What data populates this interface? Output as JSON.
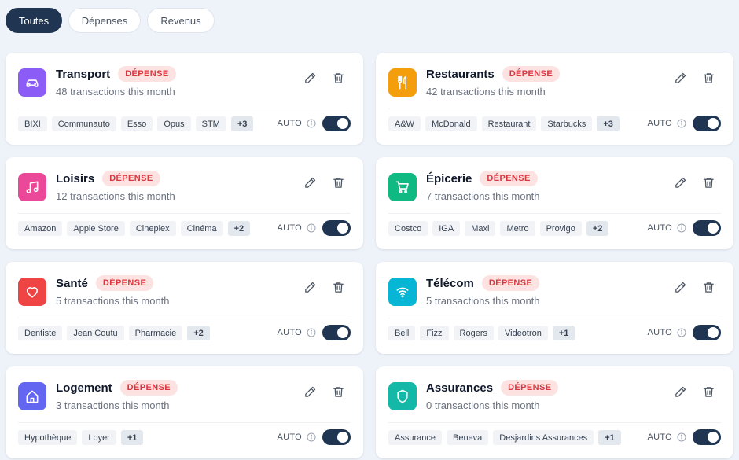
{
  "filters": [
    {
      "label": "Toutes",
      "active": true
    },
    {
      "label": "Dépenses",
      "active": false
    },
    {
      "label": "Revenus",
      "active": false
    }
  ],
  "categories": [
    {
      "name": "Transport",
      "badge": "DÉPENSE",
      "subtitle": "48 transactions this month",
      "icon": "car-icon",
      "color": "#8b5cf6",
      "tags": [
        "BIXI",
        "Communauto",
        "Esso",
        "Opus",
        "STM"
      ],
      "more": "+3",
      "auto_label": "AUTO",
      "auto_enabled": true
    },
    {
      "name": "Restaurants",
      "badge": "DÉPENSE",
      "subtitle": "42 transactions this month",
      "icon": "utensils-icon",
      "color": "#f59e0b",
      "tags": [
        "A&W",
        "McDonald",
        "Restaurant",
        "Starbucks"
      ],
      "more": "+3",
      "auto_label": "AUTO",
      "auto_enabled": true
    },
    {
      "name": "Loisirs",
      "badge": "DÉPENSE",
      "subtitle": "12 transactions this month",
      "icon": "music-icon",
      "color": "#ec4899",
      "tags": [
        "Amazon",
        "Apple Store",
        "Cineplex",
        "Cinéma"
      ],
      "more": "+2",
      "auto_label": "AUTO",
      "auto_enabled": true
    },
    {
      "name": "Épicerie",
      "badge": "DÉPENSE",
      "subtitle": "7 transactions this month",
      "icon": "cart-icon",
      "color": "#10b981",
      "tags": [
        "Costco",
        "IGA",
        "Maxi",
        "Metro",
        "Provigo"
      ],
      "more": "+2",
      "auto_label": "AUTO",
      "auto_enabled": true
    },
    {
      "name": "Santé",
      "badge": "DÉPENSE",
      "subtitle": "5 transactions this month",
      "icon": "heart-icon",
      "color": "#ef4444",
      "tags": [
        "Dentiste",
        "Jean Coutu",
        "Pharmacie"
      ],
      "more": "+2",
      "auto_label": "AUTO",
      "auto_enabled": true
    },
    {
      "name": "Télécom",
      "badge": "DÉPENSE",
      "subtitle": "5 transactions this month",
      "icon": "wifi-icon",
      "color": "#06b6d4",
      "tags": [
        "Bell",
        "Fizz",
        "Rogers",
        "Videotron"
      ],
      "more": "+1",
      "auto_label": "AUTO",
      "auto_enabled": true
    },
    {
      "name": "Logement",
      "badge": "DÉPENSE",
      "subtitle": "3 transactions this month",
      "icon": "home-icon",
      "color": "#6366f1",
      "tags": [
        "Hypothèque",
        "Loyer"
      ],
      "more": "+1",
      "auto_label": "AUTO",
      "auto_enabled": true
    },
    {
      "name": "Assurances",
      "badge": "DÉPENSE",
      "subtitle": "0 transactions this month",
      "icon": "shield-icon",
      "color": "#14b8a6",
      "tags": [
        "Assurance",
        "Beneva",
        "Desjardins Assurances"
      ],
      "more": "+1",
      "auto_label": "AUTO",
      "auto_enabled": true
    }
  ]
}
